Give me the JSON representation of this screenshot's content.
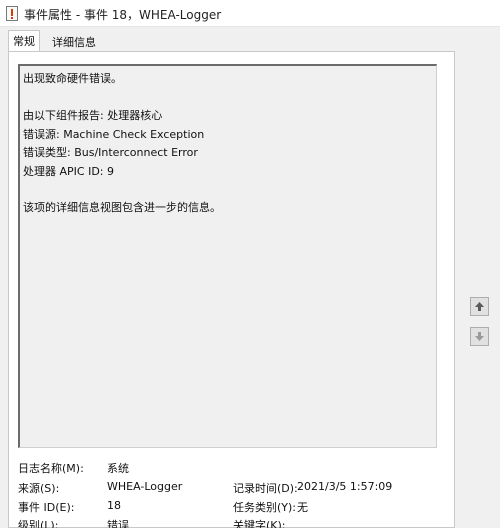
{
  "window": {
    "title": "事件属性 - 事件 18，WHEA-Logger"
  },
  "tabs": [
    {
      "label": "常规"
    },
    {
      "label": "详细信息"
    }
  ],
  "description": {
    "lines": [
      "出现致命硬件错误。",
      "由以下组件报告: 处理器核心",
      "错误源: Machine Check Exception",
      "错误类型: Bus/Interconnect Error",
      "处理器 APIC ID: 9",
      "该项的详细信息视图包含进一步的信息。"
    ]
  },
  "nav": {
    "up_icon": "arrow-up-icon",
    "down_icon": "arrow-down-icon"
  },
  "fields": {
    "log_name": {
      "label": "日志名称(M):",
      "value": "系统"
    },
    "source": {
      "label": "来源(S):",
      "value": "WHEA-Logger"
    },
    "logged": {
      "label": "记录时间(D):",
      "value": "2021/3/5 1:57:09"
    },
    "event_id": {
      "label": "事件 ID(E):",
      "value": "18"
    },
    "task_category": {
      "label": "任务类别(Y):",
      "value": "无"
    },
    "level": {
      "label": "级别(L):",
      "value": "错误"
    },
    "keywords": {
      "label": "关键字(K):",
      "value": ""
    }
  }
}
